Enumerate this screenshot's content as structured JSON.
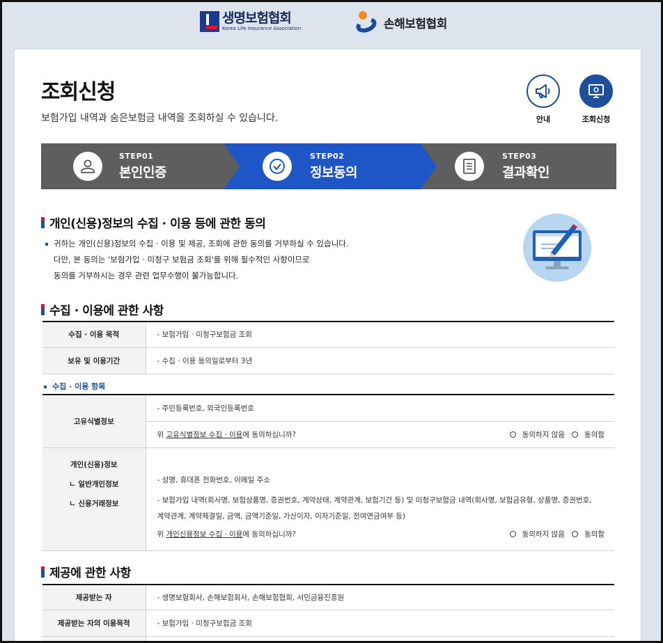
{
  "header": {
    "klia_name": "생명보험협회",
    "klia_en": "Korea Life Insurance Association",
    "gia_name": "손해보험협회"
  },
  "page": {
    "title": "조회신청",
    "description": "보험가입 내역과 숨은보험금 내역을 조회하실 수 있습니다.",
    "actions": [
      {
        "label": "안내",
        "icon": "megaphone-icon"
      },
      {
        "label": "조회신청",
        "icon": "monitor-icon"
      }
    ]
  },
  "steps": [
    {
      "step": "STEP01",
      "label": "본인인증",
      "icon": "person-icon",
      "state": "done"
    },
    {
      "step": "STEP02",
      "label": "정보동의",
      "icon": "check-icon",
      "state": "active"
    },
    {
      "step": "STEP03",
      "label": "결과확인",
      "icon": "document-icon",
      "state": "pending"
    }
  ],
  "colors": {
    "active_step": "#1e56c8",
    "inactive_step": "#5e5e5e",
    "accent": "#1d4f9c",
    "red_accent": "#d7192e"
  },
  "consent": {
    "title": "개인(신용)정보의 수집 · 이용 등에 관한 동의",
    "line1": "귀하는 개인(신용)정보의 수집 · 이용 및 제공, 조회에 관한 동의를 거부하실 수 있습니다.",
    "line2": "다만, 본 동의는 '보험가입 · 미청구 보험금 조회'를 위해 필수적인 사항이므로",
    "line3": "동의를 거부하시는 경우 관련 업무수행이 불가능합니다."
  },
  "collection": {
    "title": "수집 · 이용에 관한 사항",
    "rows": [
      {
        "label": "수집 · 이용 목적",
        "value": "- 보험가입 · 미청구보험금 조회"
      },
      {
        "label": "보유 및 이용기간",
        "value": "- 수집 · 이용 동의일로부터 3년"
      }
    ],
    "items_heading": "수집 · 이용 항목",
    "unique_id": {
      "label": "고유식별정보",
      "value": "- 주민등록번호, 외국인등록번호",
      "question_pre": "위 ",
      "question_link": "고유식별정보 수집 · 이용",
      "question_post": "에 동의하십니까?"
    },
    "personal": {
      "label": "개인(신용)정보",
      "sub1": "ㄴ 일반개인정보",
      "sub2": "ㄴ 신용거래정보",
      "value1": "- 성명, 휴대폰 전화번호, 이메일 주소",
      "value2": "- 보험가입 내역(회사명, 보험상품명, 증권번호, 계약상태, 계약관계, 보험기간 등) 및 미청구보험금 내역(회사명, 보험금유형, 상품명, 증권번호,",
      "value3": "계약관계, 계약체결일, 금액, 금액기준일, 가산이자, 이자기준일, 전여연금여부 등)",
      "question_pre": "위 ",
      "question_link": "개인신용정보 수집 · 이용",
      "question_post": "에 동의하십니까?"
    },
    "radio_disagree": "동의하지 않음",
    "radio_agree": "동의함"
  },
  "provision": {
    "title": "제공에 관한 사항",
    "rows": [
      {
        "label": "제공받는 자",
        "value": "- 생명보험회사, 손해보험회사, 손해보험협회, 서민금융진흥원"
      },
      {
        "label": "제공받는 자의 이용목적",
        "value": "- 보험가입 · 미청구보험금 조회"
      }
    ]
  }
}
